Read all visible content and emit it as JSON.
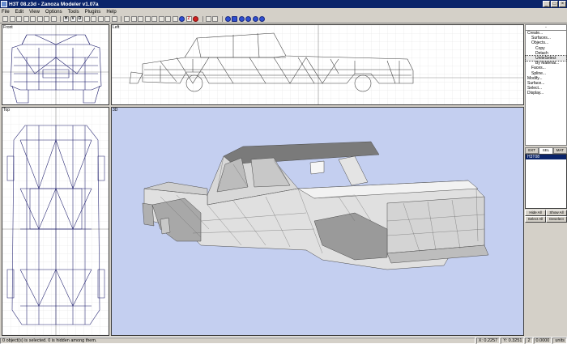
{
  "window": {
    "title": "H3T 08.z3d - Zanoza Modeler v1.07a",
    "min": "_",
    "max": "□",
    "close": "×"
  },
  "menu": [
    "File",
    "Edit",
    "View",
    "Options",
    "Tools",
    "Plugins",
    "Help"
  ],
  "toolbar_text_buttons": [
    "H",
    "V",
    "D",
    "Z"
  ],
  "viewports": {
    "front": "Front",
    "left": "Left",
    "top": "Top",
    "persp": "3D"
  },
  "rollup": {
    "header": "-",
    "items": [
      {
        "label": "Create...",
        "indent": 0
      },
      {
        "label": "Surfaces...",
        "indent": 1
      },
      {
        "label": "Objects...",
        "indent": 1
      },
      {
        "label": "Copy",
        "indent": 2
      },
      {
        "label": "Detach",
        "indent": 2
      },
      {
        "label": "UniteSelect",
        "indent": 2,
        "selected": true
      },
      {
        "label": "By Material...",
        "indent": 2
      },
      {
        "label": "Faces...",
        "indent": 1
      },
      {
        "label": "Spline...",
        "indent": 1
      },
      {
        "label": "Modify...",
        "indent": 0
      },
      {
        "label": "Surface...",
        "indent": 0
      },
      {
        "label": "Select...",
        "indent": 0
      },
      {
        "label": "Display...",
        "indent": 0
      }
    ]
  },
  "tabs": [
    "EXT",
    "SEL",
    "MAT"
  ],
  "objects": [
    "H3T08"
  ],
  "buttons": {
    "hide_all": "Hide All",
    "show_all": "Show All",
    "select_all": "Select All",
    "deselect": "Deselect"
  },
  "status": {
    "message": "0 object(s) is selected. 0 is hidden among them.",
    "x": "X: 0.2257",
    "y": "Y: 0.3251",
    "z": "2",
    "zoom": "0.0000",
    "units": "units"
  }
}
